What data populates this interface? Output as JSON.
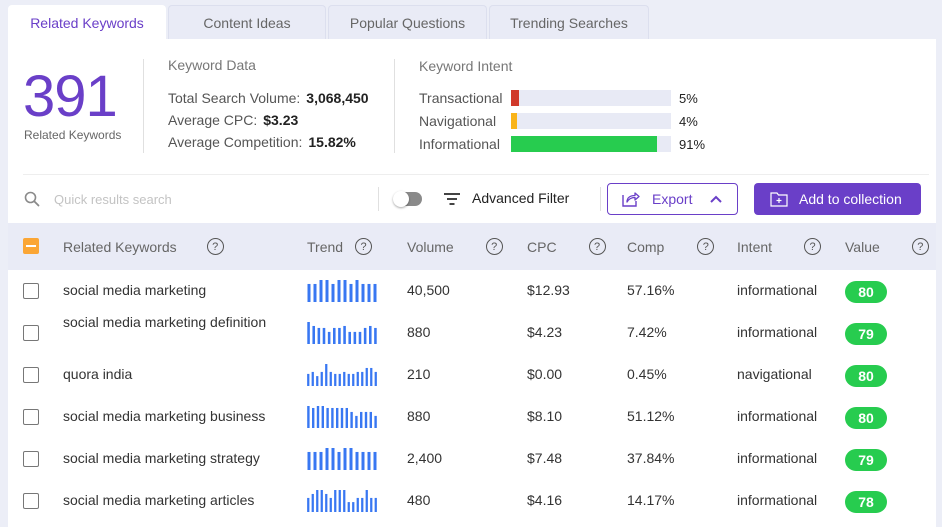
{
  "tabs": [
    {
      "label": "Related Keywords",
      "active": true
    },
    {
      "label": "Content Ideas",
      "active": false
    },
    {
      "label": "Popular Questions",
      "active": false
    },
    {
      "label": "Trending Searches",
      "active": false
    }
  ],
  "summary": {
    "count": "391",
    "count_label": "Related Keywords",
    "keyword_data": {
      "title": "Keyword Data",
      "total_search_volume_label": "Total Search Volume:",
      "total_search_volume": "3,068,450",
      "avg_cpc_label": "Average CPC:",
      "avg_cpc": "$3.23",
      "avg_competition_label": "Average Competition:",
      "avg_competition": "15.82%"
    },
    "keyword_intent": {
      "title": "Keyword Intent",
      "items": [
        {
          "label": "Transactional",
          "percent": 5,
          "percent_text": "5%",
          "color": "#d0392b"
        },
        {
          "label": "Navigational",
          "percent": 4,
          "percent_text": "4%",
          "color": "#f9b41a"
        },
        {
          "label": "Informational",
          "percent": 91,
          "percent_text": "91%",
          "color": "#27cc4f"
        }
      ]
    }
  },
  "toolbar": {
    "search_placeholder": "Quick results search",
    "search_value": "",
    "toggle_on": false,
    "advanced_filter_label": "Advanced Filter",
    "export_label": "Export",
    "add_to_collection_label": "Add to collection"
  },
  "table": {
    "headers": {
      "keyword": "Related Keywords",
      "trend": "Trend",
      "volume": "Volume",
      "cpc": "CPC",
      "comp": "Comp",
      "intent": "Intent",
      "value": "Value"
    },
    "help_glyph": "?",
    "rows": [
      {
        "keyword": "social media marketing",
        "volume": "40,500",
        "cpc": "$12.93",
        "comp": "57.16%",
        "intent": "informational",
        "value": "80",
        "trend": [
          0.82,
          0.82,
          1,
          1,
          0.82,
          1,
          1,
          0.82,
          1,
          0.82,
          0.82,
          0.82
        ]
      },
      {
        "keyword": "social media marketing definition",
        "volume": "880",
        "cpc": "$4.23",
        "comp": "7.42%",
        "intent": "informational",
        "value": "79",
        "trend": [
          1,
          0.82,
          0.73,
          0.73,
          0.55,
          0.73,
          0.73,
          0.82,
          0.55,
          0.55,
          0.55,
          0.73,
          0.82,
          0.73
        ]
      },
      {
        "keyword": "quora india",
        "volume": "210",
        "cpc": "$0.00",
        "comp": "0.45%",
        "intent": "navigational",
        "value": "80",
        "trend": [
          0.55,
          0.64,
          0.45,
          0.64,
          1,
          0.64,
          0.55,
          0.55,
          0.64,
          0.55,
          0.55,
          0.64,
          0.64,
          0.82,
          0.82,
          0.64
        ]
      },
      {
        "keyword": "social media marketing business",
        "volume": "880",
        "cpc": "$8.10",
        "comp": "51.12%",
        "intent": "informational",
        "value": "80",
        "trend": [
          1,
          0.91,
          1,
          1,
          0.91,
          0.91,
          0.91,
          0.91,
          0.91,
          0.73,
          0.55,
          0.73,
          0.73,
          0.73,
          0.55
        ]
      },
      {
        "keyword": "social media marketing strategy",
        "volume": "2,400",
        "cpc": "$7.48",
        "comp": "37.84%",
        "intent": "informational",
        "value": "79",
        "trend": [
          0.82,
          0.82,
          0.82,
          1,
          1,
          0.82,
          1,
          1,
          0.82,
          0.82,
          0.82,
          0.82
        ]
      },
      {
        "keyword": "social media marketing articles",
        "volume": "480",
        "cpc": "$4.16",
        "comp": "14.17%",
        "intent": "informational",
        "value": "78",
        "trend": [
          0.64,
          0.82,
          1,
          1,
          0.82,
          0.64,
          1,
          1,
          1,
          0.45,
          0.45,
          0.64,
          0.64,
          1,
          0.64,
          0.64
        ]
      }
    ]
  },
  "colors": {
    "brand": "#6a3fc8",
    "trend_bar": "#3877f2",
    "score_green": "#27cc4f",
    "checkbox_partial": "#fba635"
  }
}
